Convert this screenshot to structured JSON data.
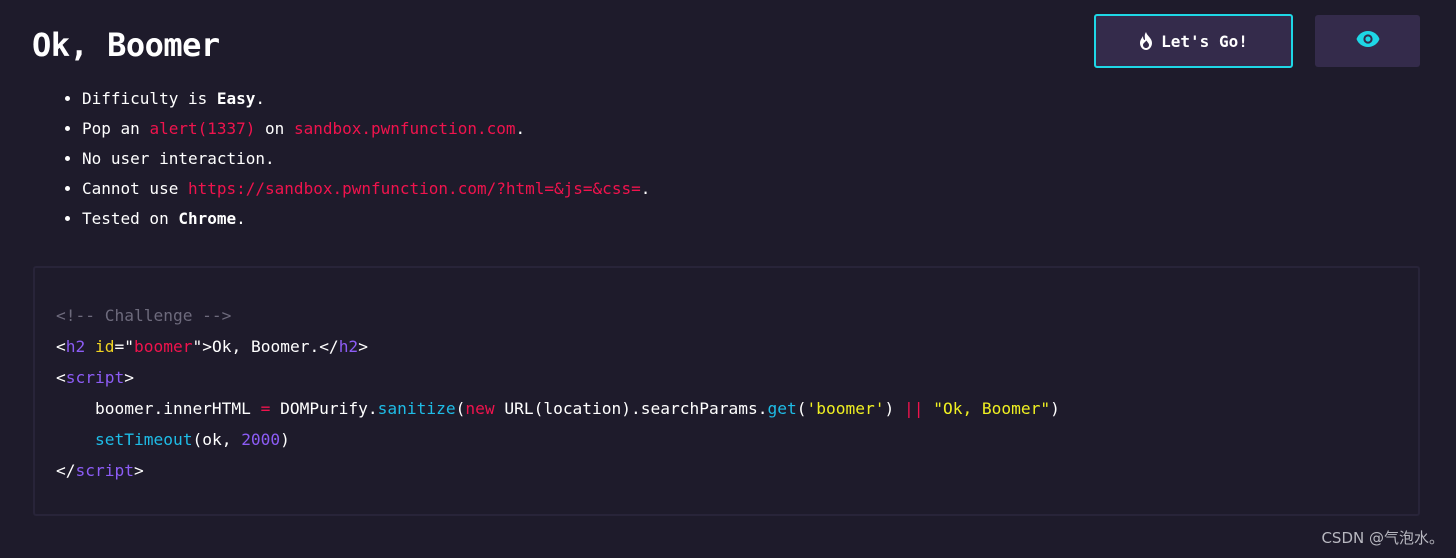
{
  "header": {
    "title": "Ok, Boomer",
    "go_button_label": "Let's Go!"
  },
  "rules": {
    "difficulty_prefix": "Difficulty is ",
    "difficulty_value": "Easy",
    "difficulty_suffix": ".",
    "pop_prefix": "Pop an ",
    "pop_code": "alert(1337)",
    "pop_mid": " on ",
    "pop_domain": "sandbox.pwnfunction.com",
    "pop_suffix": ".",
    "no_interaction": "No user interaction.",
    "cannot_prefix": "Cannot use ",
    "cannot_url": "https://sandbox.pwnfunction.com/?html=&js=&css=",
    "cannot_suffix": ".",
    "tested_prefix": "Tested on ",
    "tested_browser": "Chrome",
    "tested_suffix": "."
  },
  "code": {
    "comment": "<!-- Challenge -->",
    "h2_open_bracket": "<",
    "h2_tag": "h2",
    "h2_attr": "id",
    "h2_eq": "=\"",
    "h2_id": "boomer",
    "h2_close_quote": "\">",
    "h2_text": "Ok, Boomer.",
    "h2_end_open": "</",
    "h2_end_close": ">",
    "script_open_lt": "<",
    "script_tag": "script",
    "script_open_gt": ">",
    "line3_indent": "    ",
    "line3_obj": "boomer.innerHTML ",
    "line3_eq": "=",
    "line3_dp": " DOMPurify.",
    "line3_sanitize": "sanitize",
    "line3_paren": "(",
    "line3_new": "new",
    "line3_url": " URL(location).searchParams.",
    "line3_get": "get",
    "line3_arg": "(",
    "line3_arg_str": "'boomer'",
    "line3_arg_close": ") ",
    "line3_or": "||",
    "line3_space": " ",
    "line3_default": "\"Ok, Boomer\"",
    "line3_end": ")",
    "line4_indent": "    ",
    "line4_fn": "setTimeout",
    "line4_args": "(ok, ",
    "line4_num": "2000",
    "line4_end": ")",
    "script_close_lt": "</",
    "script_close_tag": "script",
    "script_close_gt": ">"
  },
  "watermark": "CSDN @气泡水。",
  "colors": {
    "background": "#1e1b2b",
    "button_bg": "#342b4b",
    "accent_cyan": "#1ed7e6",
    "highlight_red": "#f0134d"
  },
  "icons": {
    "go_button": "flame-icon",
    "view_button": "eye-icon"
  }
}
